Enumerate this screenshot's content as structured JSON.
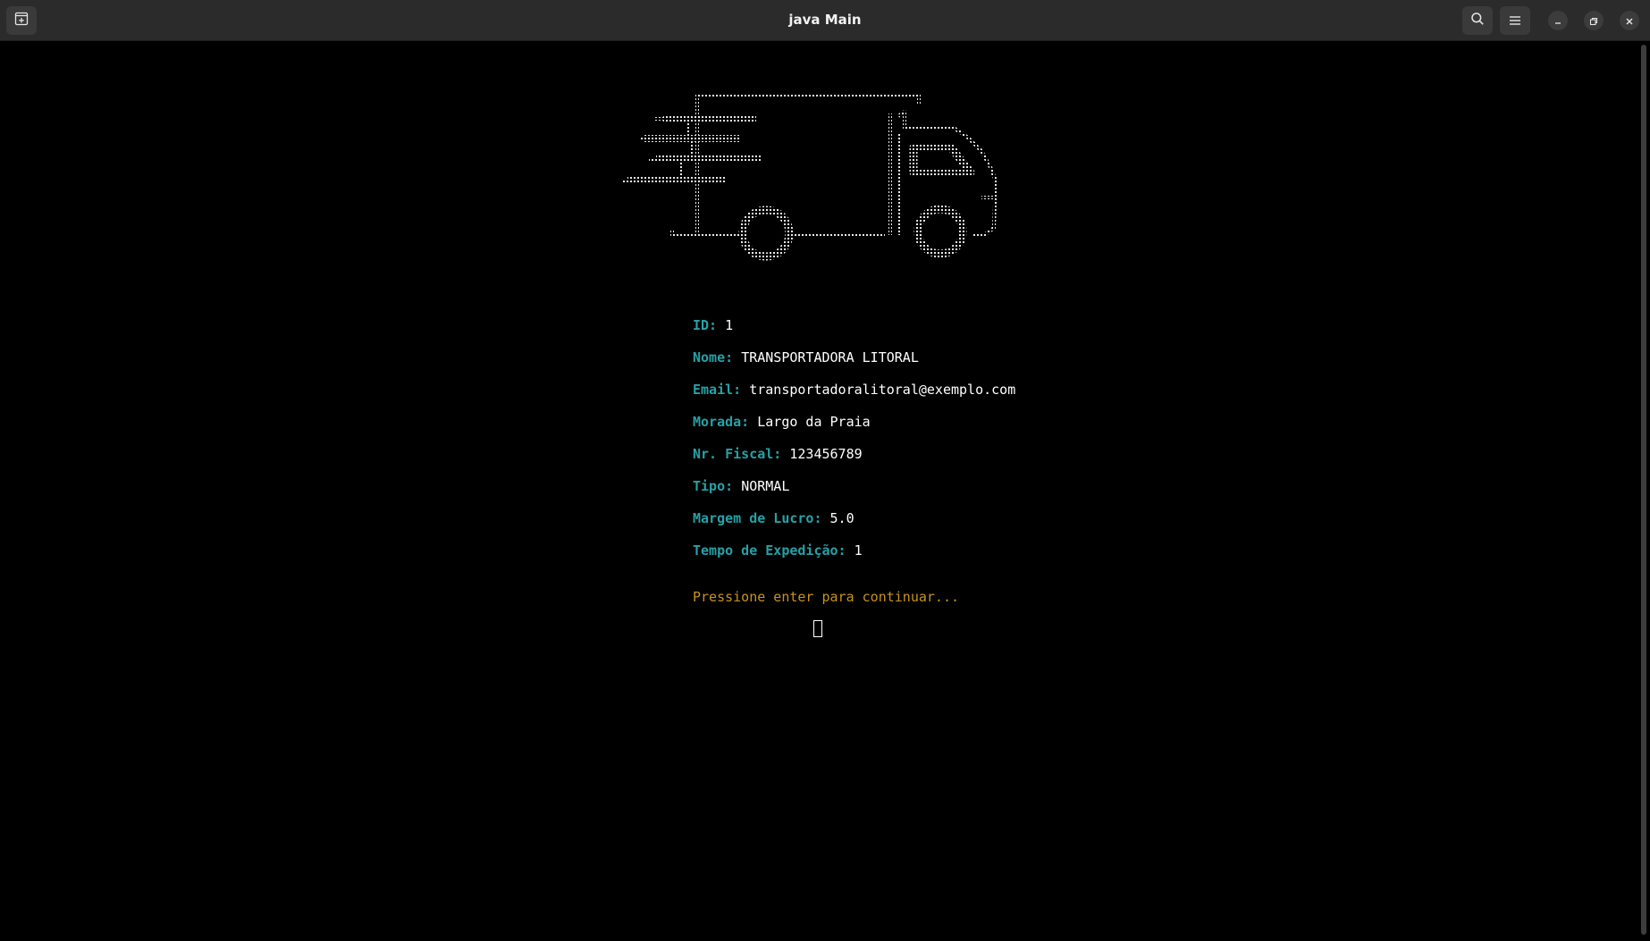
{
  "window": {
    "title": "java Main"
  },
  "icons": {
    "new_tab": "new-tab-icon",
    "search": "search-icon",
    "menu": "hamburger-menu-icon",
    "minimize": "minimize-icon",
    "restore": "restore-icon",
    "close": "close-icon",
    "art": "delivery-truck-ascii-art"
  },
  "colors": {
    "label": "#26a1a6",
    "value": "#ffffff",
    "prompt": "#c7931b",
    "background": "#000000"
  },
  "record": {
    "fields": [
      {
        "label": "ID:",
        "value": "1"
      },
      {
        "label": "Nome:",
        "value": "TRANSPORTADORA LITORAL"
      },
      {
        "label": "Email:",
        "value": "transportadoralitoral@exemplo.com"
      },
      {
        "label": "Morada:",
        "value": "Largo da Praia"
      },
      {
        "label": "Nr. Fiscal:",
        "value": "123456789"
      },
      {
        "label": "Tipo:",
        "value": "NORMAL"
      },
      {
        "label": "Margem de Lucro:",
        "value": "5.0"
      },
      {
        "label": "Tempo de Expedição:",
        "value": "1"
      }
    ]
  },
  "prompt": "Pressione enter para continuar..."
}
